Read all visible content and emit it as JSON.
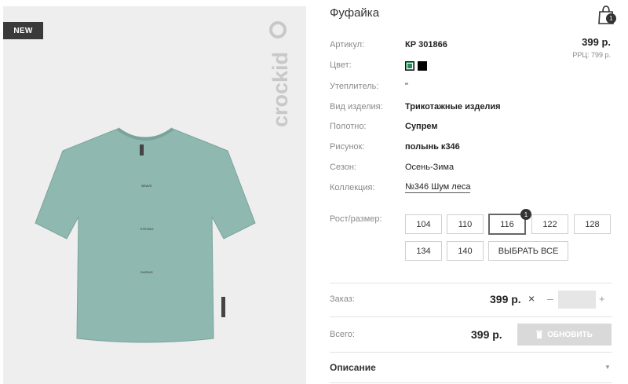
{
  "product": {
    "title": "Фуфайка",
    "badge": "NEW",
    "brand": "crockid",
    "print_words": [
      "BRAVE",
      "STRONG",
      "DARING"
    ],
    "price": "399 р.",
    "rrp": "РРЦ: 799 р.",
    "cart_count": "1",
    "attributes": [
      {
        "label": "Артикул:",
        "value": "КР 301866"
      },
      {
        "label": "Цвет:",
        "value": ""
      },
      {
        "label": "Утеплитель:",
        "value": "\""
      },
      {
        "label": "Вид изделия:",
        "value": "Трикотажные изделия"
      },
      {
        "label": "Полотно:",
        "value": "Супрем"
      },
      {
        "label": "Рисунок:",
        "value": "полынь к346"
      },
      {
        "label": "Сезон:",
        "value": "Осень-Зима"
      },
      {
        "label": "Коллекция:",
        "value": "№346 Шум леса"
      }
    ],
    "colors": [
      "#2e8b57",
      "#000000"
    ],
    "size_label": "Рост/размер:",
    "sizes": [
      "104",
      "110",
      "116",
      "122",
      "128",
      "134",
      "140"
    ],
    "selected_size": "116",
    "selected_size_count": "1",
    "select_all_label": "ВЫБРАТЬ ВСЕ",
    "order_label": "Заказ:",
    "order_price": "399 р.",
    "times_symbol": "×",
    "minus_symbol": "–",
    "plus_symbol": "+",
    "quantity": "",
    "total_label": "Всего:",
    "total_price": "399 р.",
    "update_label": "ОБНОВИТЬ",
    "description_label": "Описание"
  }
}
